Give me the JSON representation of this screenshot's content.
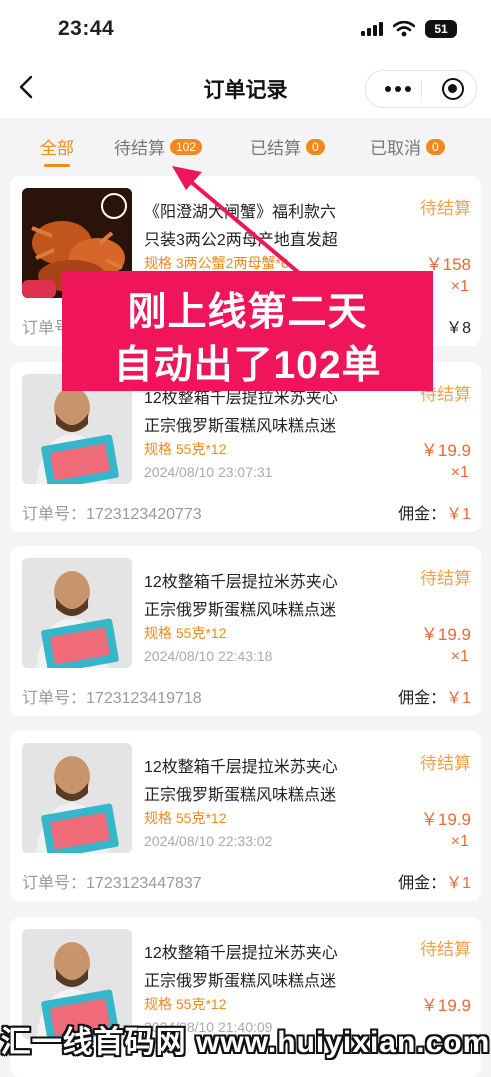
{
  "status_bar": {
    "time": "23:44",
    "battery": "51"
  },
  "nav": {
    "title": "订单记录"
  },
  "tabs": [
    {
      "label": "全部",
      "badge": ""
    },
    {
      "label": "待结算",
      "badge": "102"
    },
    {
      "label": "已结算",
      "badge": "0"
    },
    {
      "label": "已取消",
      "badge": "0"
    }
  ],
  "orders": [
    {
      "title1": "《阳澄湖大闸蟹》福利款六",
      "title2": "只装3两公2两母产地直发超",
      "spec": "规格 3两公蟹2两母蟹*6",
      "date": "",
      "status": "待结算",
      "price": "￥158",
      "qty": "×1",
      "order_label": "订单号",
      "order_no": "",
      "commission_label": "佣金：",
      "commission": "￥8"
    },
    {
      "title1": "12枚整箱千层提拉米苏夹心",
      "title2": "正宗俄罗斯蛋糕风味糕点迷",
      "spec": "规格 55克*12",
      "date": "2024/08/10 23:07:31",
      "status": "待结算",
      "price": "￥19.9",
      "qty": "×1",
      "order_label": "订单号：",
      "order_no": "1723123420773",
      "commission_label": "佣金：",
      "commission": "￥1"
    },
    {
      "title1": "12枚整箱千层提拉米苏夹心",
      "title2": "正宗俄罗斯蛋糕风味糕点迷",
      "spec": "规格 55克*12",
      "date": "2024/08/10 22:43:18",
      "status": "待结算",
      "price": "￥19.9",
      "qty": "×1",
      "order_label": "订单号：",
      "order_no": "1723123419718",
      "commission_label": "佣金：",
      "commission": "￥1"
    },
    {
      "title1": "12枚整箱千层提拉米苏夹心",
      "title2": "正宗俄罗斯蛋糕风味糕点迷",
      "spec": "规格 55克*12",
      "date": "2024/08/10 22:33:02",
      "status": "待结算",
      "price": "￥19.9",
      "qty": "×1",
      "order_label": "订单号：",
      "order_no": "1723123447837",
      "commission_label": "佣金：",
      "commission": "￥1"
    },
    {
      "title1": "12枚整箱千层提拉米苏夹心",
      "title2": "正宗俄罗斯蛋糕风味糕点迷",
      "spec": "规格 55克*12",
      "date": "2024/08/10 21:40:09",
      "status": "待结算",
      "price": "￥19.9",
      "qty": "×1",
      "order_label": "",
      "order_no": "",
      "commission_label": "",
      "commission": ""
    }
  ],
  "overlay": {
    "line1": "刚上线第二天",
    "line2": "自动出了102单"
  },
  "watermark": "汇一线首码网 www.huiyixian.com",
  "colors": {
    "accent": "#f08a1c",
    "price": "#e8693b",
    "overlay": "#f0145a"
  }
}
